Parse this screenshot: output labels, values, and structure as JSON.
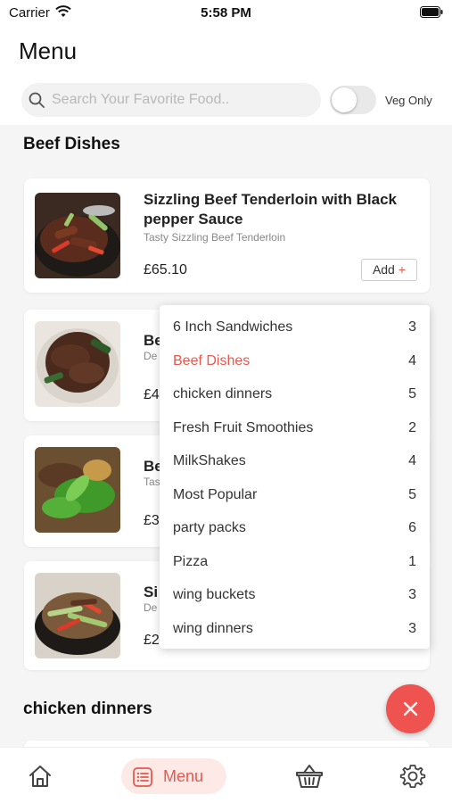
{
  "status_bar": {
    "carrier": "Carrier",
    "time": "5:58 PM"
  },
  "header": {
    "title": "Menu",
    "search_placeholder": "Search Your Favorite Food..",
    "veg_only_label": "Veg Only",
    "veg_only_enabled": false
  },
  "sections": [
    {
      "title": "Beef Dishes",
      "items": [
        {
          "name": "Sizzling Beef Tenderloin with Black pepper Sauce",
          "description": "Tasty Sizzling Beef Tenderloin",
          "price": "£65.10",
          "add_label": "Add",
          "add_icon": "+"
        },
        {
          "name": "Be",
          "description": "De",
          "price": "£4"
        },
        {
          "name": "Be",
          "description": "Tas",
          "price": "£3"
        },
        {
          "name": "Si",
          "description": "De",
          "price": "£2"
        }
      ]
    },
    {
      "title": "chicken dinners"
    }
  ],
  "category_dropdown": {
    "items": [
      {
        "name": "6 Inch Sandwiches",
        "count": "3"
      },
      {
        "name": "Beef Dishes",
        "count": "4",
        "active": true
      },
      {
        "name": "chicken dinners",
        "count": "5"
      },
      {
        "name": "Fresh Fruit Smoothies",
        "count": "2"
      },
      {
        "name": "MilkShakes",
        "count": "4"
      },
      {
        "name": "Most Popular",
        "count": "5"
      },
      {
        "name": "party packs",
        "count": "6"
      },
      {
        "name": "Pizza",
        "count": "1"
      },
      {
        "name": "wing buckets",
        "count": "3"
      },
      {
        "name": "wing dinners",
        "count": "3"
      }
    ]
  },
  "fab": {
    "icon": "close-icon"
  },
  "bottom_nav": {
    "items": [
      {
        "icon": "home-icon"
      },
      {
        "icon": "menu-list-icon",
        "label": "Menu",
        "active": true
      },
      {
        "icon": "basket-icon"
      },
      {
        "icon": "settings-icon"
      }
    ]
  },
  "colors": {
    "accent": "#e8584e",
    "fab": "#ef5350",
    "active_nav_bg": "#fdeae6"
  }
}
